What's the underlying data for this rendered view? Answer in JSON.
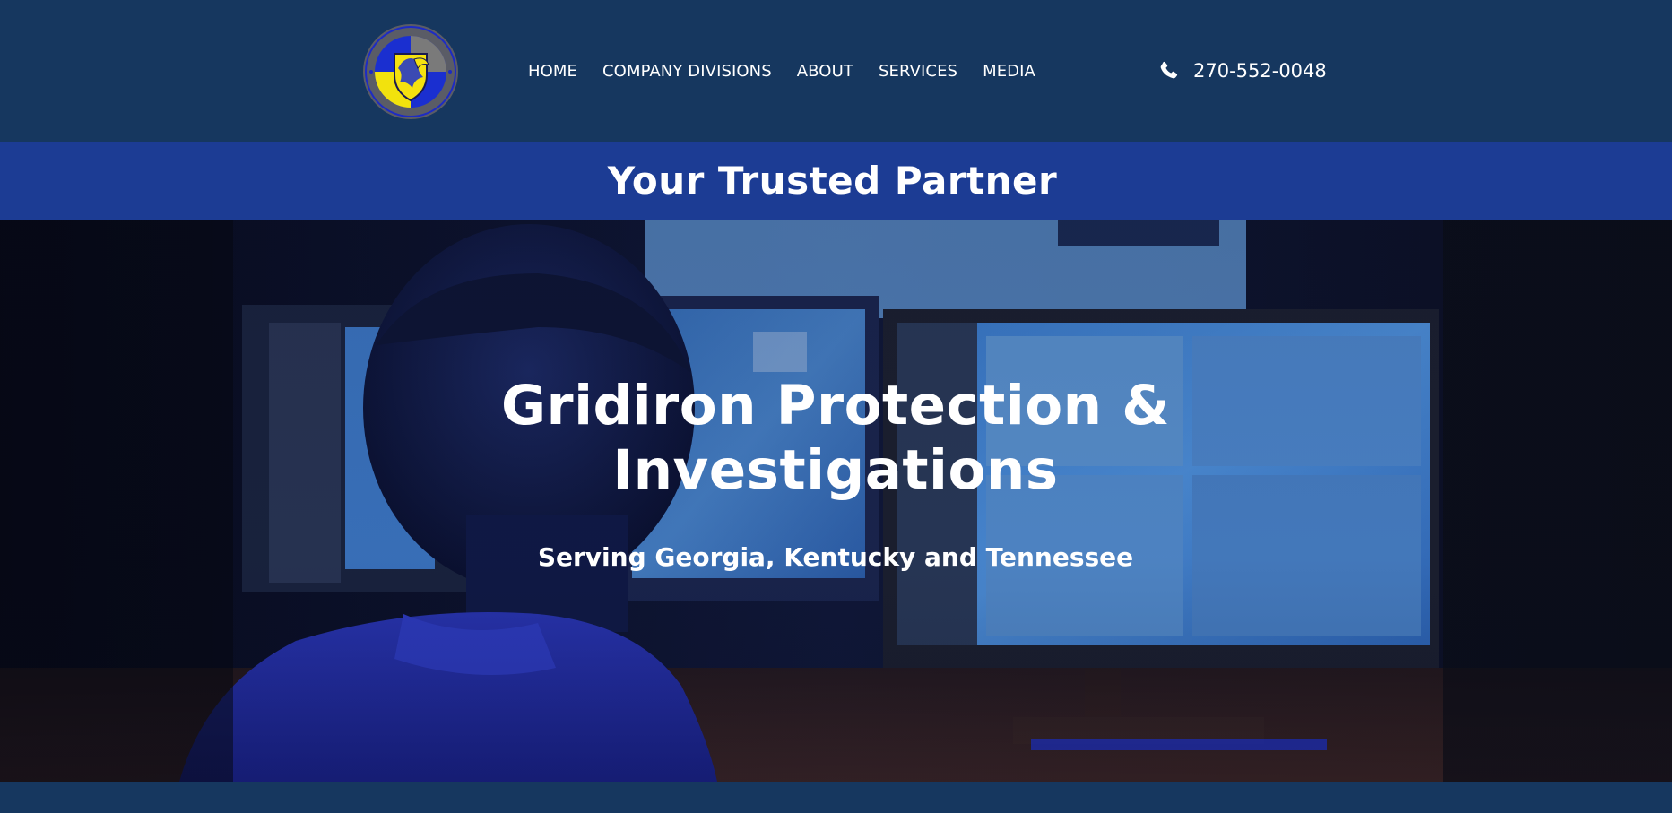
{
  "header": {
    "logo_icon": "gridiron-protection-shield-logo",
    "logo_text": "GRIDIRON PROTECTION & INVESTIGATIONS",
    "nav": [
      {
        "label": "HOME"
      },
      {
        "label": "COMPANY DIVISIONS"
      },
      {
        "label": "ABOUT"
      },
      {
        "label": "SERVICES"
      },
      {
        "label": "MEDIA"
      }
    ],
    "phone": {
      "icon": "phone-icon",
      "number": "270-552-0048"
    },
    "background_color": "#16375f"
  },
  "tagline_bar": {
    "text": "Your Trusted Partner",
    "background_color": "#1c3c94"
  },
  "hero": {
    "title": "Gridiron Protection & Investigations",
    "subtitle": "Serving Georgia, Kentucky and Tennessee",
    "background_image": "security-operator-monitoring-screens-photo"
  },
  "colors": {
    "accent_yellow": "#f5e10f",
    "accent_blue": "#1a2fd0",
    "text": "#ffffff"
  }
}
